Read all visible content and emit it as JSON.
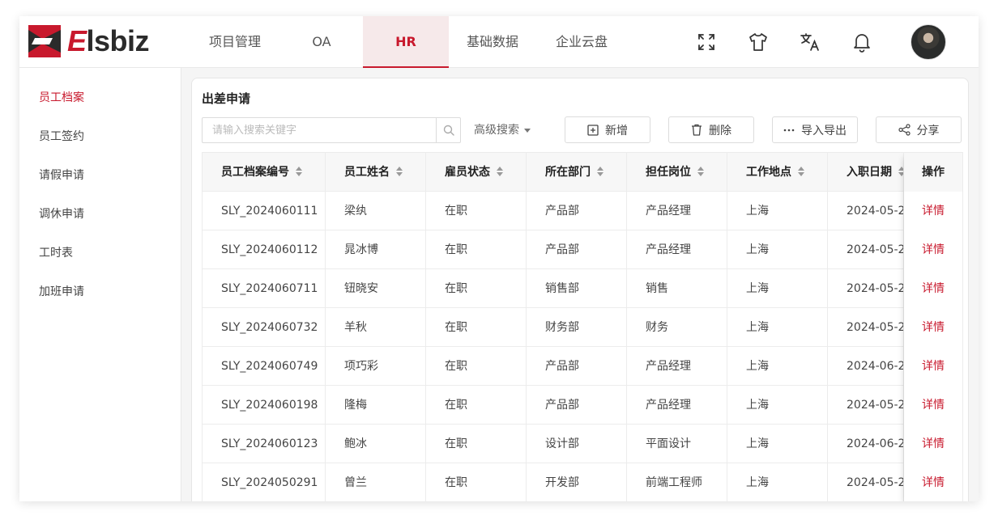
{
  "brand": {
    "logo_e": "E",
    "logo_rest": "lsbiz"
  },
  "nav": [
    {
      "label": "项目管理"
    },
    {
      "label": "OA"
    },
    {
      "label": "HR",
      "active": true
    },
    {
      "label": "基础数据"
    },
    {
      "label": "企业云盘"
    }
  ],
  "toolbar_icons": [
    "fullscreen-icon",
    "theme-shirt-icon",
    "translate-icon",
    "bell-icon"
  ],
  "sidebar": {
    "items": [
      {
        "label": "员工档案",
        "active": true
      },
      {
        "label": "员工签约"
      },
      {
        "label": "请假申请"
      },
      {
        "label": "调休申请"
      },
      {
        "label": "工时表"
      },
      {
        "label": "加班申请"
      }
    ]
  },
  "page": {
    "title": "出差申请",
    "search_placeholder": "请输入搜索关键字",
    "advanced_search": "高级搜索",
    "buttons": {
      "add": "新增",
      "delete": "删除",
      "import_export": "导入导出",
      "share": "分享"
    }
  },
  "table": {
    "columns": [
      "员工档案编号",
      "员工姓名",
      "雇员状态",
      "所在部门",
      "担任岗位",
      "工作地点",
      "入职日期",
      "操作"
    ],
    "rows": [
      [
        "SLY_2024060111",
        "梁纨",
        "在职",
        "产品部",
        "产品经理",
        "上海",
        "2024-05-2",
        "详情"
      ],
      [
        "SLY_2024060112",
        "晁冰博",
        "在职",
        "产品部",
        "产品经理",
        "上海",
        "2024-05-2",
        "详情"
      ],
      [
        "SLY_2024060711",
        "钮晓安",
        "在职",
        "销售部",
        "销售",
        "上海",
        "2024-05-2",
        "详情"
      ],
      [
        "SLY_2024060732",
        "羊秋",
        "在职",
        "财务部",
        "财务",
        "上海",
        "2024-05-2",
        "详情"
      ],
      [
        "SLY_2024060749",
        "项巧彩",
        "在职",
        "产品部",
        "产品经理",
        "上海",
        "2024-06-2",
        "详情"
      ],
      [
        "SLY_2024060198",
        "隆梅",
        "在职",
        "产品部",
        "产品经理",
        "上海",
        "2024-05-2",
        "详情"
      ],
      [
        "SLY_2024060123",
        "鲍冰",
        "在职",
        "设计部",
        "平面设计",
        "上海",
        "2024-06-2",
        "详情"
      ],
      [
        "SLY_2024050291",
        "曾兰",
        "在职",
        "开发部",
        "前端工程师",
        "上海",
        "2024-05-2",
        "详情"
      ]
    ]
  },
  "colors": {
    "accent": "#c8192d",
    "nav_active_bg": "#f6e9ea"
  }
}
